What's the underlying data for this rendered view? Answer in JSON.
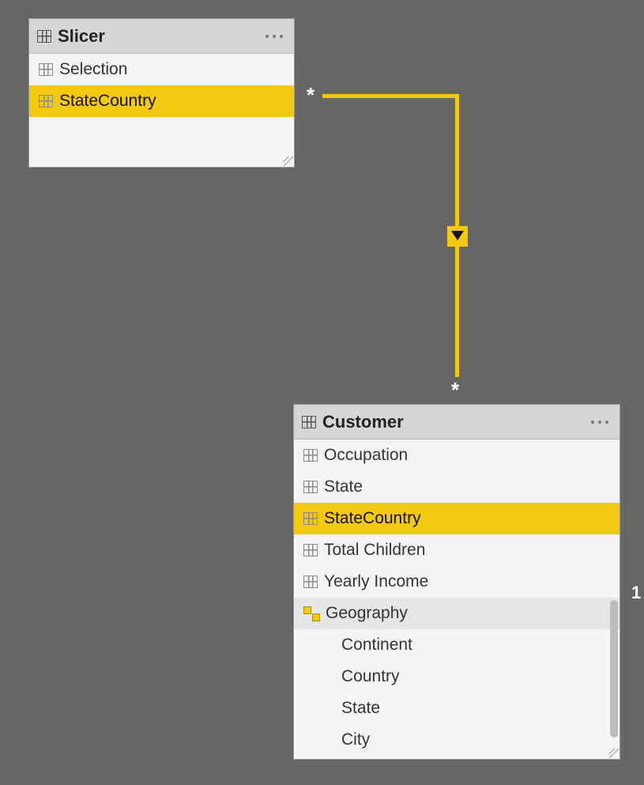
{
  "tables": {
    "slicer": {
      "title": "Slicer",
      "rows": [
        {
          "label": "Selection",
          "selected": false
        },
        {
          "label": "StateCountry",
          "selected": true
        }
      ]
    },
    "customer": {
      "title": "Customer",
      "rows": [
        {
          "label": "Occupation",
          "type": "column"
        },
        {
          "label": "State",
          "type": "column"
        },
        {
          "label": "StateCountry",
          "type": "column",
          "selected": true
        },
        {
          "label": "Total Children",
          "type": "column"
        },
        {
          "label": "Yearly Income",
          "type": "column"
        },
        {
          "label": "Geography",
          "type": "hierarchy",
          "highlight": true
        },
        {
          "label": "Continent",
          "type": "level"
        },
        {
          "label": "Country",
          "type": "level"
        },
        {
          "label": "State",
          "type": "level"
        },
        {
          "label": "City",
          "type": "level"
        }
      ]
    }
  },
  "relationship": {
    "from_cardinality": "*",
    "to_cardinality": "*",
    "filter_direction": "single"
  },
  "annotations": {
    "outer_marker": "1"
  }
}
